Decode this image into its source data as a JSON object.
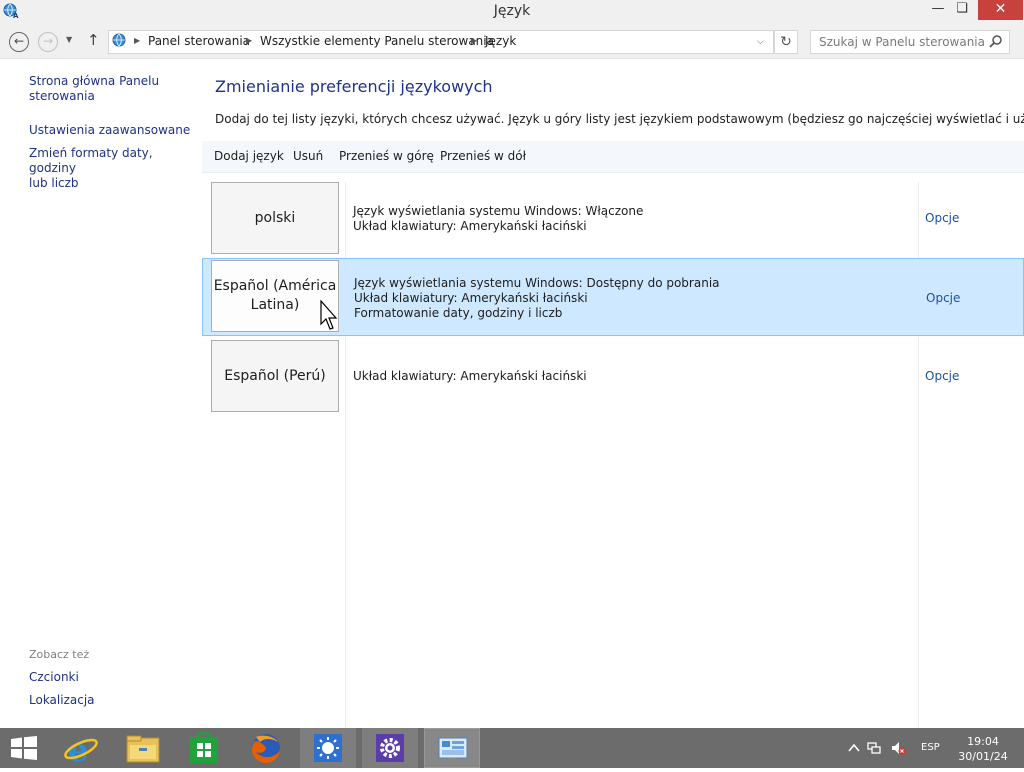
{
  "window": {
    "title": "Język"
  },
  "address": {
    "breadcrumbs": [
      "Panel sterowania",
      "Wszystkie elementy Panelu sterowania",
      "Język"
    ],
    "search_placeholder": "Szukaj w Panelu sterowania"
  },
  "sidebar": {
    "links": [
      [
        "Strona główna Panelu",
        "sterowania"
      ],
      [
        "Ustawienia zaawansowane"
      ],
      [
        "Zmień formaty daty, godziny",
        "lub liczb"
      ]
    ],
    "see_also_title": "Zobacz też",
    "see_also": [
      "Czcionki",
      "Lokalizacja"
    ]
  },
  "main": {
    "title": "Zmienianie preferencji językowych",
    "description": "Dodaj do tej listy języki, których chcesz używać. Język u góry listy jest językiem podstawowym (będziesz go najczęściej wyświetlać i używać).",
    "toolbar": [
      "Dodaj język",
      "Usuń",
      "Przenieś w górę",
      "Przenieś w dół"
    ],
    "languages": [
      {
        "name": [
          "polski"
        ],
        "details": [
          "Język wyświetlania systemu Windows: Włączone",
          "Układ klawiatury: Amerykański łaciński"
        ],
        "options": "Opcje"
      },
      {
        "name": [
          "Español (América",
          "Latina)"
        ],
        "details": [
          "Język wyświetlania systemu Windows: Dostępny do pobrania",
          "Układ klawiatury: Amerykański łaciński",
          "Formatowanie daty, godziny i liczb"
        ],
        "options": "Opcje",
        "selected": true
      },
      {
        "name": [
          "Español (Perú)"
        ],
        "details": [
          "Układ klawiatury: Amerykański łaciński"
        ],
        "options": "Opcje"
      }
    ]
  },
  "taskbar": {
    "apps": [
      "start-icon",
      "internet-explorer-icon",
      "file-explorer-icon",
      "store-icon",
      "firefox-icon",
      "brightness-icon",
      "settings-gear-icon",
      "control-panel-icon"
    ],
    "language_indicator": "ESP",
    "time": "19:04",
    "date": "30/01/24"
  },
  "colors": {
    "link": "#1e3287",
    "selection": "#cde8ff",
    "close_button": "#c7413d",
    "taskbar": "#6c6c6c"
  }
}
